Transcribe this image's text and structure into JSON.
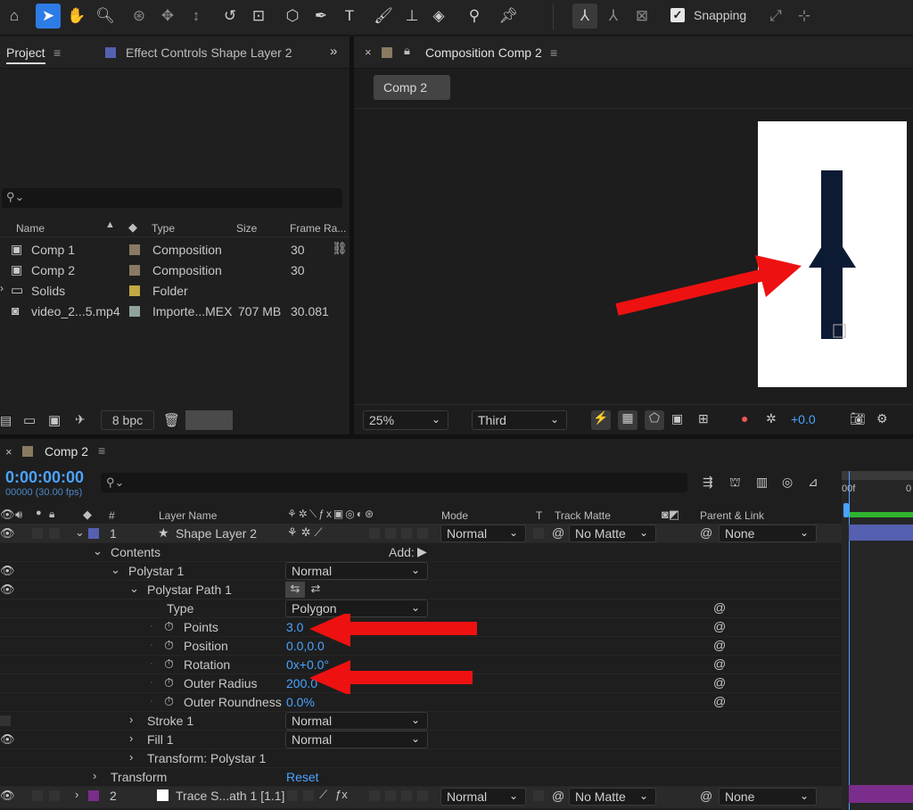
{
  "toolbar": {
    "snapping_label": "Snapping"
  },
  "project_panel": {
    "tab_project": "Project",
    "tab_effect_controls": "Effect Controls Shape Layer 2",
    "search_placeholder": "",
    "columns": [
      "Name",
      "Type",
      "Size",
      "Frame Ra..."
    ],
    "items": [
      {
        "name": "Comp 1",
        "color": "#8a7a62",
        "type": "Composition",
        "size": "",
        "fps": "30"
      },
      {
        "name": "Comp 2",
        "color": "#8a7a62",
        "type": "Composition",
        "size": "",
        "fps": "30"
      },
      {
        "name": "Solids",
        "color": "#c2a941",
        "type": "Folder",
        "size": "",
        "fps": ""
      },
      {
        "name": "video_2...5.mp4",
        "color": "#8fa39c",
        "type": "Importe...MEX",
        "size": "707 MB",
        "fps": "30.081"
      }
    ],
    "bpc": "8 bpc"
  },
  "composition_panel": {
    "title": "Composition Comp 2",
    "comp_tab": "Comp 2",
    "zoom": "25%",
    "resolution": "Third",
    "exposure": "+0.0"
  },
  "timeline": {
    "title": "Comp 2",
    "timecode": "0:00:00:00",
    "frames": "00000 (30.00 fps)",
    "ruler_labels": [
      "00f",
      "0"
    ],
    "col_layer_name": "Layer Name",
    "col_num": "#",
    "col_mode": "Mode",
    "col_t": "T",
    "col_track_matte": "Track Matte",
    "col_parent": "Parent & Link",
    "layer1": {
      "num": "1",
      "name": "Shape Layer 2",
      "mode": "Normal",
      "matte": "No Matte",
      "parent": "None"
    },
    "contents_label": "Contents",
    "add_label": "Add:",
    "polystar": {
      "label": "Polystar 1",
      "mode": "Normal"
    },
    "polystar_path_label": "Polystar Path 1",
    "props": [
      {
        "label": "Type",
        "value": "Polygon"
      },
      {
        "label": "Points",
        "value": "3.0"
      },
      {
        "label": "Position",
        "value": "0.0,0.0"
      },
      {
        "label": "Rotation",
        "value": "0x+0.0°"
      },
      {
        "label": "Outer Radius",
        "value": "200.0"
      },
      {
        "label": "Outer Roundness",
        "value": "0.0%"
      }
    ],
    "stroke": {
      "label": "Stroke 1",
      "mode": "Normal"
    },
    "fill": {
      "label": "Fill 1",
      "mode": "Normal"
    },
    "transform_polystar": "Transform: Polystar 1",
    "transform": {
      "label": "Transform",
      "reset": "Reset"
    },
    "layer2": {
      "num": "2",
      "name": "Trace S...ath 1 [1.1]",
      "mode": "Normal",
      "matte": "No Matte",
      "parent": "None"
    }
  },
  "colors": {
    "accent": "#2d7be5",
    "value_blue": "#4aa3ff",
    "arrow_red": "#ee1111",
    "shape_navy": "#0c1a33",
    "layer1_label": "#5560b0",
    "layer2_label": "#7a2d8a"
  }
}
